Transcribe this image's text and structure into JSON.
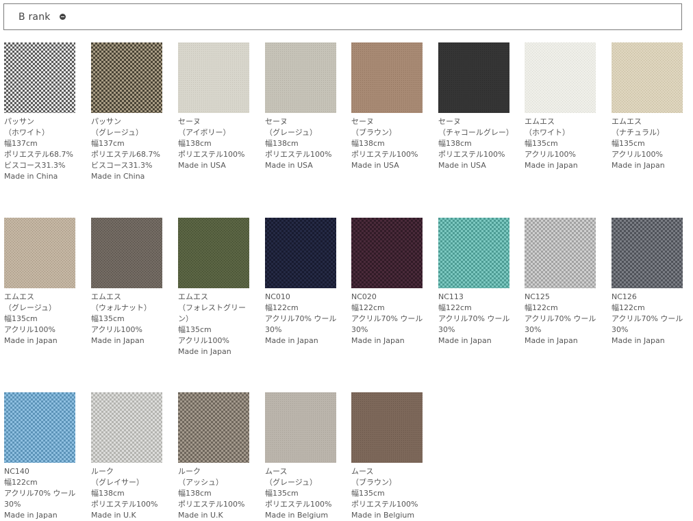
{
  "header": {
    "title": "B rank",
    "toggle_icon": "minus-circle-icon"
  },
  "swatches": [
    {
      "name": "パッサン",
      "color": "（ホワイト）",
      "width": "幅137cm",
      "material": "ポリエステル68.7%\nビスコース31.3%",
      "origin": "Made in China",
      "pattern": "weave",
      "base": "#e6e6e6",
      "accent": "#5a5a5a"
    },
    {
      "name": "パッサン",
      "color": "（グレージュ）",
      "width": "幅137cm",
      "material": "ポリエステル68.7%\nビスコース31.3%",
      "origin": "Made in China",
      "pattern": "weave",
      "base": "#a89c84",
      "accent": "#4a4436"
    },
    {
      "name": "セーヌ",
      "color": "（アイボリー）",
      "width": "幅138cm",
      "material": "ポリエステル100%",
      "origin": "Made in USA",
      "pattern": "flat",
      "base": "#d8d6cc",
      "accent": "#c6c3b8"
    },
    {
      "name": "セーヌ",
      "color": "（グレージュ）",
      "width": "幅138cm",
      "material": "ポリエステル100%",
      "origin": "Made in USA",
      "pattern": "flat",
      "base": "#c6c3b8",
      "accent": "#b1ada2"
    },
    {
      "name": "セーヌ",
      "color": "（ブラウン）",
      "width": "幅138cm",
      "material": "ポリエステル100%",
      "origin": "Made in USA",
      "pattern": "flat",
      "base": "#a88a74",
      "accent": "#93755f"
    },
    {
      "name": "セーヌ",
      "color": "（チャコールグレー）",
      "width": "幅138cm",
      "material": "ポリエステル100%",
      "origin": "Made in USA",
      "pattern": "flat",
      "base": "#353535",
      "accent": "#2a2a2a"
    },
    {
      "name": "エムエス",
      "color": "（ホワイト）",
      "width": "幅135cm",
      "material": "アクリル100%",
      "origin": "Made in Japan",
      "pattern": "fuzzy",
      "base": "#eeeee8",
      "accent": "#dadad2"
    },
    {
      "name": "エムエス",
      "color": "（ナチュラル）",
      "width": "幅135cm",
      "material": "アクリル100%",
      "origin": "Made in Japan",
      "pattern": "fuzzy",
      "base": "#ddd4bd",
      "accent": "#c3b899"
    },
    {
      "name": "エムエス",
      "color": "（グレージュ）",
      "width": "幅135cm",
      "material": "アクリル100%",
      "origin": "Made in Japan",
      "pattern": "fuzzy",
      "base": "#c3b5a2",
      "accent": "#9f8f7b"
    },
    {
      "name": "エムエス",
      "color": "（ウォルナット）",
      "width": "幅135cm",
      "material": "アクリル100%",
      "origin": "Made in Japan",
      "pattern": "fuzzy",
      "base": "#726a62",
      "accent": "#4f4842"
    },
    {
      "name": "エムエス",
      "color": "（フォレストグリーン）",
      "width": "幅135cm",
      "material": "アクリル100%",
      "origin": "Made in Japan",
      "pattern": "fuzzy",
      "base": "#5a6443",
      "accent": "#3d472c"
    },
    {
      "name": "NC010",
      "color": "",
      "width": "幅122cm",
      "material": "アクリル70% ウール30%",
      "origin": "Made in Japan",
      "pattern": "weave",
      "base": "#252a45",
      "accent": "#181b30"
    },
    {
      "name": "NC020",
      "color": "",
      "width": "幅122cm",
      "material": "アクリル70% ウール30%",
      "origin": "Made in Japan",
      "pattern": "weave",
      "base": "#4a2a3a",
      "accent": "#311b27"
    },
    {
      "name": "NC113",
      "color": "",
      "width": "幅122cm",
      "material": "アクリル70% ウール30%",
      "origin": "Made in Japan",
      "pattern": "weave",
      "base": "#7cc8c0",
      "accent": "#4d9c94"
    },
    {
      "name": "NC125",
      "color": "",
      "width": "幅122cm",
      "material": "アクリル70% ウール30%",
      "origin": "Made in Japan",
      "pattern": "weave",
      "base": "#cfcfcf",
      "accent": "#a2a2a2"
    },
    {
      "name": "NC126",
      "color": "",
      "width": "幅122cm",
      "material": "アクリル70% ウール30%",
      "origin": "Made in Japan",
      "pattern": "weave",
      "base": "#7a7d84",
      "accent": "#4f5259"
    },
    {
      "name": "NC140",
      "color": "",
      "width": "幅122cm",
      "material": "アクリル70% ウール30%",
      "origin": "Made in Japan",
      "pattern": "weave",
      "base": "#8ebfe0",
      "accent": "#5c93b8"
    },
    {
      "name": "ルーク",
      "color": "（グレイサー）",
      "width": "幅138cm",
      "material": "ポリエステル100%",
      "origin": "Made in U.K",
      "pattern": "weave",
      "base": "#dcdcda",
      "accent": "#b4b4b0"
    },
    {
      "name": "ルーク",
      "color": "（アッシュ）",
      "width": "幅138cm",
      "material": "ポリエステル100%",
      "origin": "Made in U.K",
      "pattern": "weave",
      "base": "#a3998c",
      "accent": "#6e665c"
    },
    {
      "name": "ムース",
      "color": "（グレージュ）",
      "width": "幅135cm",
      "material": "ポリエステル100%",
      "origin": "Made in Belgium",
      "pattern": "flat",
      "base": "#bbb5ac",
      "accent": "#a9a399"
    },
    {
      "name": "ムース",
      "color": "（ブラウン）",
      "width": "幅135cm",
      "material": "ポリエステル100%",
      "origin": "Made in Belgium",
      "pattern": "flat",
      "base": "#7d685a",
      "accent": "#6a5649"
    }
  ]
}
